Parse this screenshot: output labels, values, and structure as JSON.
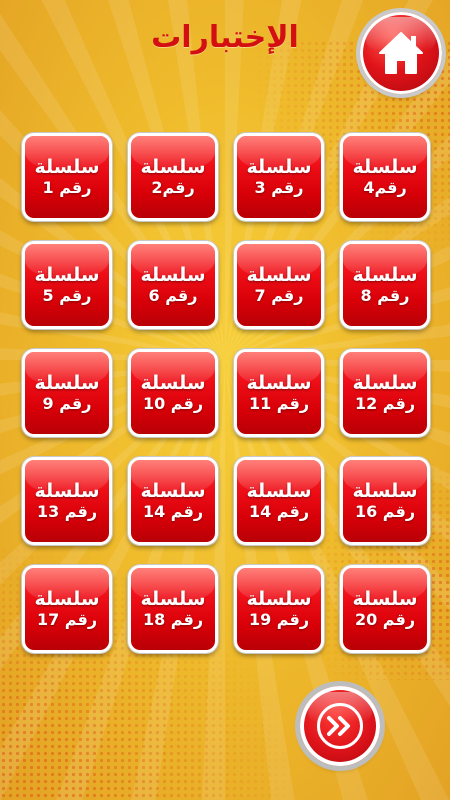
{
  "header": {
    "title": "الإختبارات",
    "home_icon": "home-icon"
  },
  "series": [
    {
      "label": "سلسلة",
      "number": "رقم 1"
    },
    {
      "label": "سلسلة",
      "number": "رقم2"
    },
    {
      "label": "سلسلة",
      "number": "رقم 3"
    },
    {
      "label": "سلسلة",
      "number": "رقم4"
    },
    {
      "label": "سلسلة",
      "number": "رقم 5"
    },
    {
      "label": "سلسلة",
      "number": "رقم 6"
    },
    {
      "label": "سلسلة",
      "number": "رقم 7"
    },
    {
      "label": "سلسلة",
      "number": "رقم 8"
    },
    {
      "label": "سلسلة",
      "number": "رقم 9"
    },
    {
      "label": "سلسلة",
      "number": "رقم 10"
    },
    {
      "label": "سلسلة",
      "number": "رقم 11"
    },
    {
      "label": "سلسلة",
      "number": "رقم 12"
    },
    {
      "label": "سلسلة",
      "number": "رقم 13"
    },
    {
      "label": "سلسلة",
      "number": "رقم 14"
    },
    {
      "label": "سلسلة",
      "number": "رقم 14"
    },
    {
      "label": "سلسلة",
      "number": "رقم 16"
    },
    {
      "label": "سلسلة",
      "number": "رقم 17"
    },
    {
      "label": "سلسلة",
      "number": "رقم 18"
    },
    {
      "label": "سلسلة",
      "number": "رقم 19"
    },
    {
      "label": "سلسلة",
      "number": "رقم 20"
    }
  ],
  "footer": {
    "next_icon": "fast-forward-icon"
  },
  "colors": {
    "background": "#efbb2c",
    "title": "#d40f12",
    "tile": "#e10a12",
    "tile_border": "#ffffff"
  }
}
